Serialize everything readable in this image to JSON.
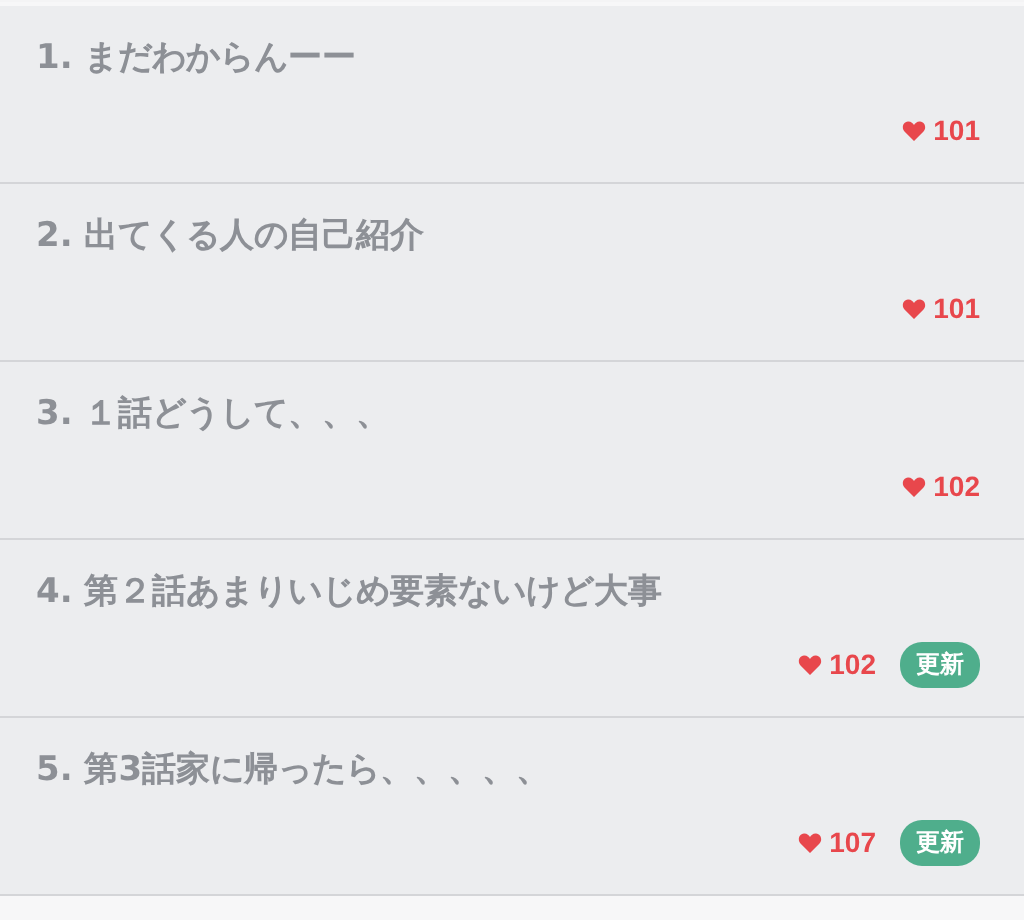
{
  "episodes": [
    {
      "title": "1. まだわからんーー",
      "likes": "101"
    },
    {
      "title": "2. 出てくる人の自己紹介",
      "likes": "101"
    },
    {
      "title": "3. １話どうして、、、",
      "likes": "102"
    },
    {
      "title": "4. 第２話あまりいじめ要素ないけど大事",
      "likes": "102",
      "badge": "更新"
    },
    {
      "title": "5. 第3話家に帰ったら、、、、、",
      "likes": "107",
      "badge": "更新"
    }
  ]
}
